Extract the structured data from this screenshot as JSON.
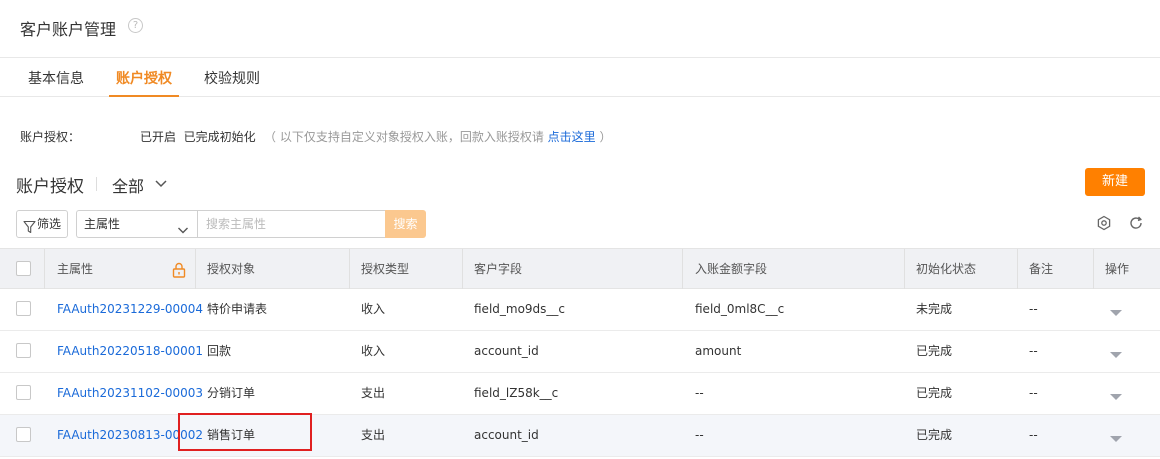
{
  "header": {
    "title": "客户账户管理",
    "help_icon": "?"
  },
  "tabs": [
    {
      "label": "基本信息",
      "active": false
    },
    {
      "label": "账户授权",
      "active": true
    },
    {
      "label": "校验规则",
      "active": false
    }
  ],
  "info": {
    "label": "账户授权：",
    "status": "已开启  已完成初始化",
    "hint_prefix": "（ 以下仅支持自定义对象授权入账，回款入账授权请 ",
    "hint_link": "点击这里",
    "hint_suffix": " ）"
  },
  "section": {
    "title": "账户授权",
    "view": "全部"
  },
  "toolbar": {
    "new_label": "新建",
    "filter_label": "筛选",
    "field_select": "主属性",
    "search_placeholder": "搜索主属性",
    "search_label": "搜索"
  },
  "table": {
    "columns": [
      "主属性",
      "授权对象",
      "授权类型",
      "客户字段",
      "入账金额字段",
      "初始化状态",
      "备注",
      "操作"
    ],
    "rows": [
      {
        "id": "FAAuth20231229-00004",
        "object": "特价申请表",
        "type": "收入",
        "customer_field": "field_mo9ds__c",
        "amount_field": "field_0ml8C__c",
        "status": "未完成",
        "remark": "--"
      },
      {
        "id": "FAAuth20220518-00001",
        "object": "回款",
        "type": "收入",
        "customer_field": "account_id",
        "amount_field": "amount",
        "status": "已完成",
        "remark": "--"
      },
      {
        "id": "FAAuth20231102-00003",
        "object": "分销订单",
        "type": "支出",
        "customer_field": "field_lZ58k__c",
        "amount_field": "--",
        "status": "已完成",
        "remark": "--"
      },
      {
        "id": "FAAuth20230813-00002",
        "object": "销售订单",
        "type": "支出",
        "customer_field": "account_id",
        "amount_field": "--",
        "status": "已完成",
        "remark": "--"
      }
    ]
  },
  "colors": {
    "accent": "#ff8000",
    "link": "#1a6ad9",
    "highlight": "#e02020"
  }
}
